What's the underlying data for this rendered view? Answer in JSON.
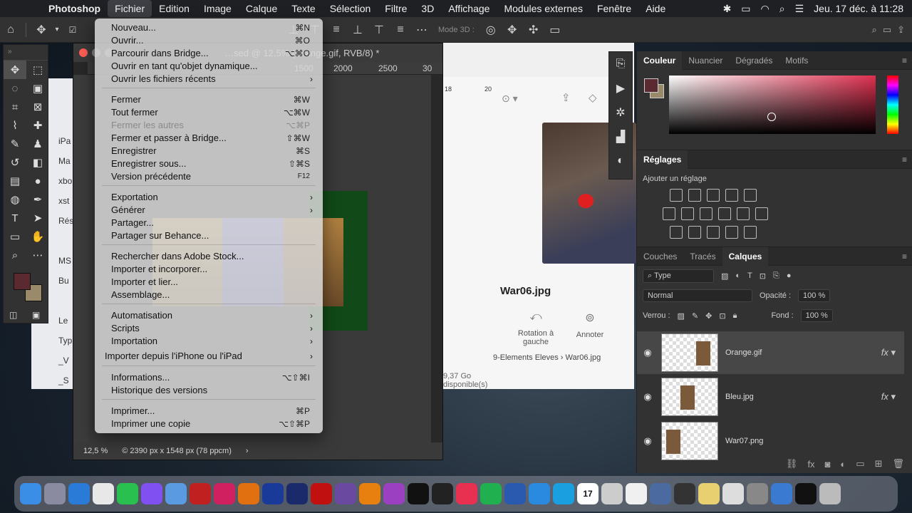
{
  "menubar": {
    "app": "Photoshop",
    "items": [
      "Fichier",
      "Edition",
      "Image",
      "Calque",
      "Texte",
      "Sélection",
      "Filtre",
      "3D",
      "Affichage",
      "Modules externes",
      "Fenêtre",
      "Aide"
    ],
    "datetime": "Jeu. 17 déc. à  11:28"
  },
  "optbar": {
    "mode3d": "Mode 3D :"
  },
  "document": {
    "title": "…sed @ 12,5% (Orange.gif, RVB/8) *",
    "ruler": [
      "1500",
      "2000",
      "2500",
      "30"
    ],
    "zoom": "12,5 %",
    "info": "© 2390 px x 1548 px (78 ppcm)"
  },
  "finder": {
    "items": [
      "iPa",
      "Ma",
      "xbo",
      "xst",
      "Rés",
      "MS",
      "Bu",
      "Le",
      "Typ",
      "_V",
      "_S"
    ]
  },
  "preview": {
    "ruler": [
      "18",
      "20"
    ],
    "filename": "War06.jpg",
    "actions": [
      {
        "label": "Rotation à gauche"
      },
      {
        "label": "Annoter"
      }
    ],
    "crumbs": "9-Elements Eleves  ›  War06.jpg",
    "space": "9,37 Go disponible(s)"
  },
  "menu": {
    "items": [
      {
        "label": "Nouveau...",
        "shortcut": "⌘N",
        "enabled": true
      },
      {
        "label": "Ouvrir...",
        "shortcut": "⌘O",
        "enabled": true
      },
      {
        "label": "Parcourir dans Bridge...",
        "shortcut": "⌥⌘O",
        "enabled": true
      },
      {
        "label": "Ouvrir en tant qu'objet dynamique...",
        "shortcut": "",
        "enabled": true
      },
      {
        "label": "Ouvrir les fichiers récents",
        "shortcut": "",
        "enabled": true,
        "submenu": true
      },
      {
        "label": "Fermer",
        "shortcut": "⌘W",
        "enabled": true
      },
      {
        "label": "Tout fermer",
        "shortcut": "⌥⌘W",
        "enabled": true
      },
      {
        "label": "Fermer les autres",
        "shortcut": "⌥⌘P",
        "enabled": false
      },
      {
        "label": "Fermer et passer à Bridge...",
        "shortcut": "⇧⌘W",
        "enabled": true
      },
      {
        "label": "Enregistrer",
        "shortcut": "⌘S",
        "enabled": true
      },
      {
        "label": "Enregistrer sous...",
        "shortcut": "⇧⌘S",
        "enabled": true
      },
      {
        "label": "Version précédente",
        "shortcut": "F12",
        "enabled": true
      },
      {
        "label": "Exportation",
        "shortcut": "",
        "enabled": true,
        "submenu": true
      },
      {
        "label": "Générer",
        "shortcut": "",
        "enabled": true,
        "submenu": true
      },
      {
        "label": "Partager...",
        "shortcut": "",
        "enabled": true
      },
      {
        "label": "Partager sur Behance...",
        "shortcut": "",
        "enabled": true
      },
      {
        "label": "Rechercher dans Adobe Stock...",
        "shortcut": "",
        "enabled": true
      },
      {
        "label": "Importer et incorporer...",
        "shortcut": "",
        "enabled": true
      },
      {
        "label": "Importer et lier...",
        "shortcut": "",
        "enabled": true
      },
      {
        "label": "Assemblage...",
        "shortcut": "",
        "enabled": true
      },
      {
        "label": "Automatisation",
        "shortcut": "",
        "enabled": true,
        "submenu": true
      },
      {
        "label": "Scripts",
        "shortcut": "",
        "enabled": true,
        "submenu": true
      },
      {
        "label": "Importation",
        "shortcut": "",
        "enabled": true,
        "submenu": true
      },
      {
        "label": "Importer depuis l'iPhone ou l'iPad",
        "shortcut": "",
        "enabled": true,
        "submenu": true
      },
      {
        "label": "Informations...",
        "shortcut": "⌥⇧⌘I",
        "enabled": true
      },
      {
        "label": "Historique des versions",
        "shortcut": "",
        "enabled": true
      },
      {
        "label": "Imprimer...",
        "shortcut": "⌘P",
        "enabled": true
      },
      {
        "label": "Imprimer une copie",
        "shortcut": "⌥⇧⌘P",
        "enabled": true
      }
    ]
  },
  "panels": {
    "color_tabs": [
      "Couleur",
      "Nuancier",
      "Dégradés",
      "Motifs"
    ],
    "fg_color": "#5a2a30",
    "bg_color": "#9a8a6a",
    "adjust_title": "Réglages",
    "adjust_sub": "Ajouter un réglage",
    "layer_tabs": [
      "Couches",
      "Tracés",
      "Calques"
    ],
    "filter": "Type",
    "blend": "Normal",
    "opacity_label": "Opacité :",
    "opacity": "100 %",
    "lock_label": "Verrou :",
    "fill_label": "Fond :",
    "fill": "100 %",
    "layers": [
      {
        "name": "Orange.gif",
        "selected": true
      },
      {
        "name": "Bleu.jpg",
        "selected": false
      },
      {
        "name": "War07.png",
        "selected": false
      }
    ]
  },
  "dock": {
    "apps": [
      "Finder",
      "Launchpad",
      "Safari",
      "Chrome",
      "WhatsApp",
      "Messenger",
      "Mail",
      "FileZilla",
      "Id",
      "Ai",
      "Ps",
      "An",
      "Acrobat",
      "iMovie",
      "VLC",
      "Podcasts",
      "TV",
      "Soundtrack",
      "Music",
      "Spotify",
      "Word",
      "Zoom",
      "Skype",
      "Calendar",
      "Dictionary",
      "Photos",
      "Archive",
      "Disk",
      "Notes",
      "Scripting",
      "Prefs",
      "Network",
      "Terminal",
      "Trash"
    ],
    "calendar_day": "17"
  }
}
